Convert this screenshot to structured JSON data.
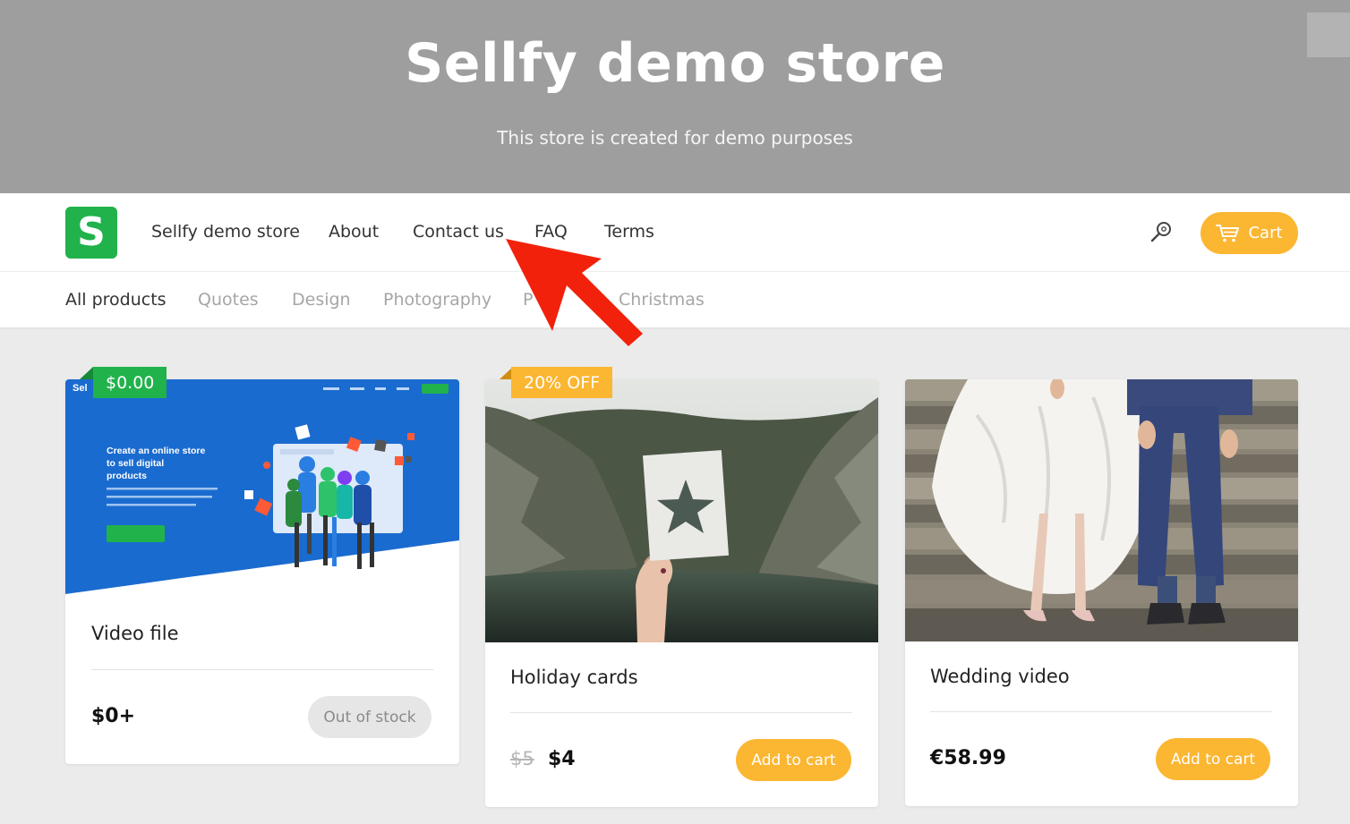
{
  "hero": {
    "title": "Sellfy demo store",
    "subtitle": "This store is created for demo purposes"
  },
  "navbar": {
    "logo_letter": "S",
    "links": [
      "Sellfy demo store",
      "About",
      "Contact us",
      "FAQ",
      "Terms"
    ],
    "search_icon": "search-icon",
    "cart_label": "Cart",
    "cart_icon": "cart-icon"
  },
  "categories": {
    "items": [
      "All products",
      "Quotes",
      "Design",
      "Photography",
      "P",
      "Christmas"
    ],
    "active": "All products"
  },
  "products": [
    {
      "title": "Video file",
      "badge": "$0.00",
      "price": "$0+",
      "old_price": "",
      "button": "Out of stock",
      "image_text": {
        "heading_line1": "Create an online store",
        "heading_line2": "to sell digital",
        "heading_line3": "products",
        "brand": "Sel"
      }
    },
    {
      "title": "Holiday cards",
      "badge": "20% OFF",
      "price": "$4",
      "old_price": "$5",
      "button": "Add to cart"
    },
    {
      "title": "Wedding video",
      "badge": "",
      "price": "€58.99",
      "old_price": "",
      "button": "Add to cart"
    }
  ],
  "colors": {
    "brand_green": "#21b24b",
    "accent_yellow": "#fbb632",
    "hero_gray": "#9e9e9e",
    "annotation_red": "#f2210c"
  }
}
